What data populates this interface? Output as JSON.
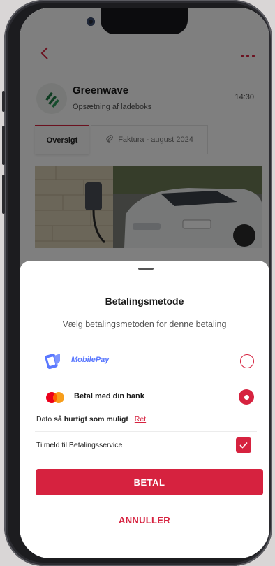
{
  "header": {
    "sender": "Greenwave",
    "subject": "Opsætning af ladeboks",
    "time": "14:30",
    "back_icon": "chevron-left-icon",
    "more_icon": "ellipsis-icon"
  },
  "tabs": [
    {
      "label": "Oversigt",
      "active": true
    },
    {
      "label": "Faktura - august 2024",
      "icon": "paperclip-icon"
    }
  ],
  "sheet": {
    "title": "Betalingsmetode",
    "subtitle": "Vælg betalingsmetoden for denne betaling",
    "options": [
      {
        "label": "MobilePay",
        "selected": false,
        "icon": "mobilepay-logo"
      },
      {
        "label": "Betal med din bank",
        "selected": true,
        "icon": "mastercard-logo"
      }
    ],
    "date_prefix": "Dato",
    "date_value": "så hurtigt som muligt",
    "date_edit": "Ret",
    "betalingsservice_label": "Tilmeld til Betalingsservice",
    "betalingsservice_checked": true,
    "pay_button": "BETAL",
    "cancel_button": "ANNULLER"
  },
  "colors": {
    "accent": "#d6223f",
    "mobilepay": "#5a78ff"
  }
}
